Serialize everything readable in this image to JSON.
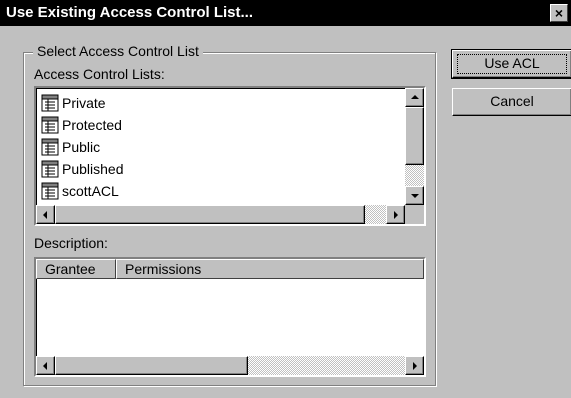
{
  "window": {
    "title": "Use Existing Access Control List...",
    "close_glyph": "×"
  },
  "group": {
    "legend": "Select Access Control List",
    "lists_label": "Access Control Lists:",
    "items": [
      {
        "label": "Private",
        "icon": "acl-list-icon"
      },
      {
        "label": "Protected",
        "icon": "acl-list-icon"
      },
      {
        "label": "Public",
        "icon": "acl-list-icon"
      },
      {
        "label": "Published",
        "icon": "acl-list-icon"
      },
      {
        "label": "scottACL",
        "icon": "acl-list-icon"
      }
    ],
    "description_label": "Description:",
    "table": {
      "columns": [
        "Grantee",
        "Permissions"
      ],
      "rows": []
    }
  },
  "buttons": {
    "use_acl": "Use ACL",
    "cancel": "Cancel"
  },
  "colors": {
    "face": "#c0c0c0",
    "title_bg": "#000000",
    "title_fg": "#ffffff"
  }
}
